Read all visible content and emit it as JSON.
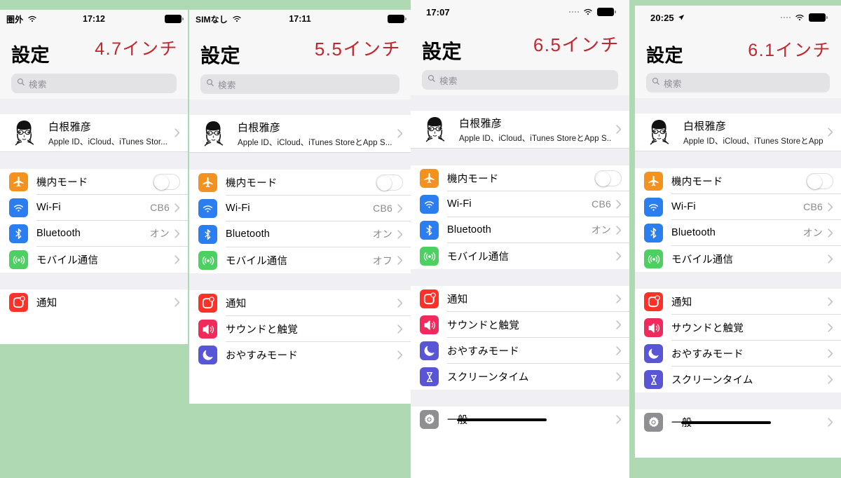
{
  "background_color": "#aed9b2",
  "accent_red": "#c0282f",
  "common": {
    "settings_title": "設定",
    "search_placeholder": "検索",
    "profile_name": "白根雅彦",
    "rows": {
      "airplane": "機内モード",
      "wifi": "Wi-Fi",
      "bluetooth": "Bluetooth",
      "cellular": "モバイル通信",
      "notifications": "通知",
      "sounds": "サウンドと触覚",
      "dnd": "おやすみモード",
      "screentime": "スクリーンタイム",
      "general": "一般"
    },
    "values": {
      "wifi_ssid": "CB6",
      "on": "オン",
      "off": "オフ"
    }
  },
  "panels": [
    {
      "id": "panel-4-7",
      "size_label": "4.7インチ",
      "status": {
        "carrier": "圏外",
        "time": "17:12",
        "style": "classic"
      },
      "profile_subtitle": "Apple ID、iCloud、iTunes Stor...",
      "cellular_value": "",
      "rows_shown": [
        "airplane",
        "wifi",
        "bluetooth",
        "cellular",
        "notifications"
      ],
      "has_home_indicator": false
    },
    {
      "id": "panel-5-5",
      "size_label": "5.5インチ",
      "status": {
        "carrier": "SIMなし",
        "time": "17:11",
        "style": "classic"
      },
      "profile_subtitle": "Apple ID、iCloud、iTunes StoreとApp S...",
      "cellular_value": "オフ",
      "rows_shown": [
        "airplane",
        "wifi",
        "bluetooth",
        "cellular",
        "notifications",
        "sounds",
        "dnd"
      ],
      "has_home_indicator": false
    },
    {
      "id": "panel-6-5",
      "size_label": "6.5インチ",
      "status": {
        "carrier": "",
        "time": "17:07",
        "style": "notch"
      },
      "profile_subtitle": "Apple ID、iCloud、iTunes StoreとApp S...",
      "cellular_value": "",
      "rows_shown": [
        "airplane",
        "wifi",
        "bluetooth",
        "cellular",
        "notifications",
        "sounds",
        "dnd",
        "screentime",
        "general"
      ],
      "has_home_indicator": true
    },
    {
      "id": "panel-6-1",
      "size_label": "6.1インチ",
      "status": {
        "carrier": "",
        "time": "20:25",
        "style": "notch",
        "location_arrow": true
      },
      "profile_subtitle": "Apple ID、iCloud、iTunes StoreとApp S...",
      "cellular_value": "",
      "rows_shown": [
        "airplane",
        "wifi",
        "bluetooth",
        "cellular",
        "notifications",
        "sounds",
        "dnd",
        "screentime",
        "general"
      ],
      "has_home_indicator": true
    }
  ],
  "icons": {
    "airplane": {
      "name": "airplane-icon",
      "color": "#f3921f"
    },
    "wifi": {
      "name": "wifi-icon",
      "color": "#2a7ef0"
    },
    "bluetooth": {
      "name": "bluetooth-icon",
      "color": "#2a7ef0"
    },
    "cellular": {
      "name": "cellular-icon",
      "color": "#4cd061"
    },
    "notifications": {
      "name": "notification-badge-icon",
      "color": "#fc3128"
    },
    "sounds": {
      "name": "speaker-icon",
      "color": "#f2295b"
    },
    "dnd": {
      "name": "moon-icon",
      "color": "#5856d6"
    },
    "screentime": {
      "name": "hourglass-icon",
      "color": "#5856d6"
    },
    "general": {
      "name": "gear-icon",
      "color": "#8e8e93"
    }
  }
}
